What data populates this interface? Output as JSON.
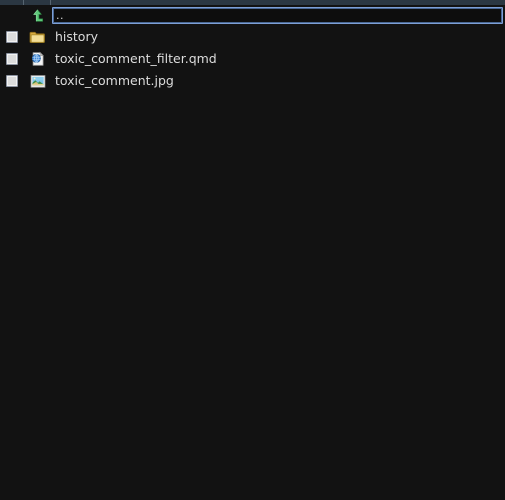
{
  "window": {
    "background_color": "#121212",
    "text_color": "#dcdcdc"
  },
  "column_header": {
    "columns": [
      {
        "name": "select-column",
        "label": ""
      },
      {
        "name": "icon-column",
        "label": ""
      },
      {
        "name": "name-column",
        "label": ""
      }
    ],
    "background_color": "#2b3742",
    "divider_color": "#566470"
  },
  "path_bar": {
    "up_icon": "arrow-up-parent-folder-icon",
    "up_icon_color": "#56c271",
    "input": {
      "value": "..",
      "placeholder": "",
      "border_color": "#7d9fd6"
    }
  },
  "files": [
    {
      "name": "history",
      "icon": "folder-icon",
      "type": "folder",
      "checked": false
    },
    {
      "name": "toxic_comment_filter.qmd",
      "icon": "document-globe-icon",
      "type": "file",
      "checked": false
    },
    {
      "name": "toxic_comment.jpg",
      "icon": "image-thumbnail-icon",
      "type": "file",
      "checked": false
    }
  ]
}
